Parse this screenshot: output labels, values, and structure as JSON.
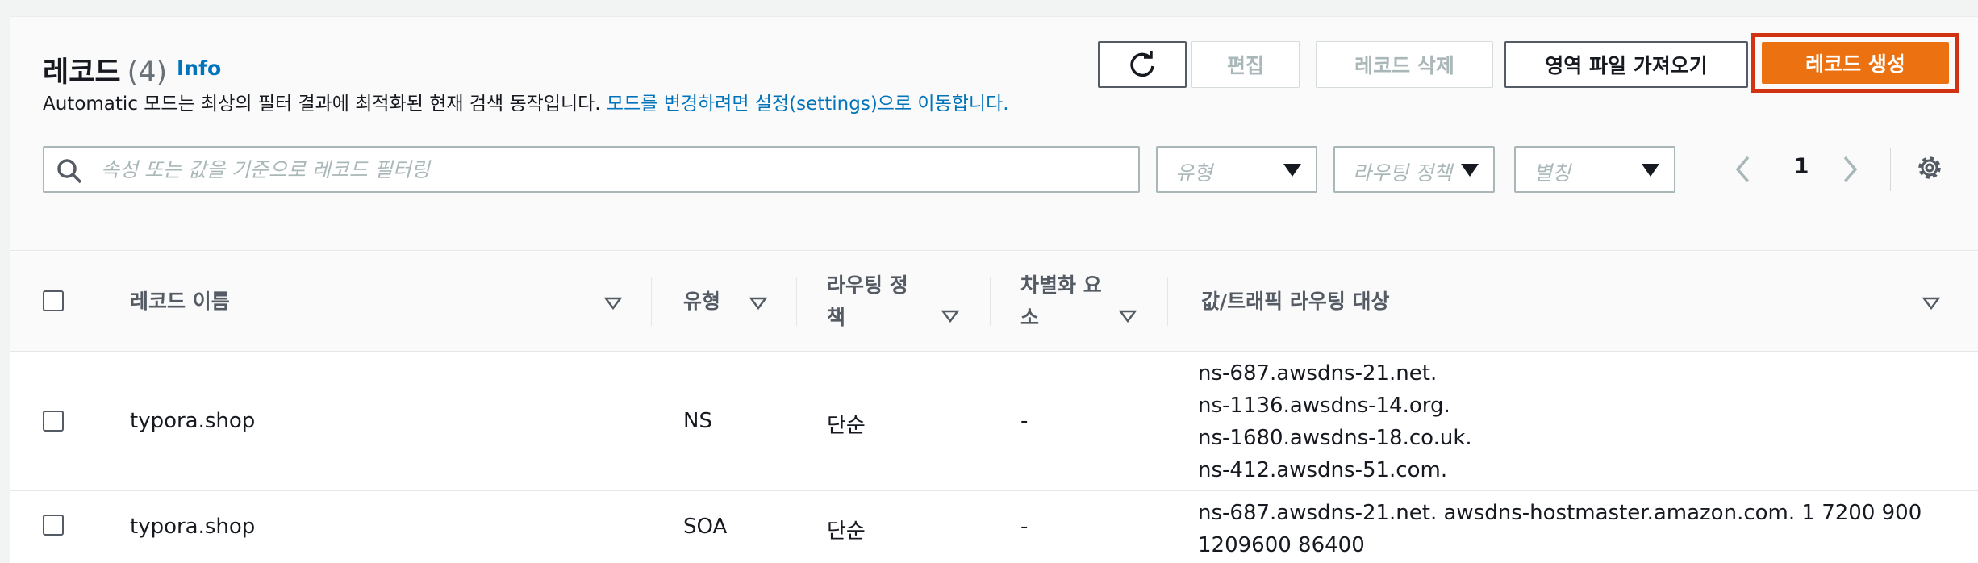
{
  "header": {
    "title": "레코드",
    "count": "(4)",
    "info": "Info",
    "description": "Automatic 모드는 최상의 필터 결과에 최적화된 현재 검색 동작입니다.",
    "description_link": "모드를 변경하려면 설정(settings)으로 이동합니다."
  },
  "toolbar": {
    "refresh_icon": "refresh-icon",
    "edit_label": "편집",
    "delete_label": "레코드 삭제",
    "import_label": "영역 파일 가져오기",
    "create_label": "레코드 생성",
    "highlight_color": "#d13212",
    "primary_color": "#ec7211"
  },
  "filters": {
    "search_placeholder": "속성 또는 값을 기준으로 레코드 필터링",
    "type_placeholder": "유형",
    "policy_placeholder": "라우팅 정책",
    "alias_placeholder": "별칭"
  },
  "pagination": {
    "current_page": "1"
  },
  "table": {
    "columns": [
      {
        "line1": "레코드 이름",
        "line2": ""
      },
      {
        "line1": "유형",
        "line2": ""
      },
      {
        "line1": "라우팅 정",
        "line2": "책"
      },
      {
        "line1": "차별화 요",
        "line2": "소"
      },
      {
        "line1": "값/트래픽 라우팅 대상",
        "line2": ""
      }
    ],
    "rows": [
      {
        "name": "typora.shop",
        "type": "NS",
        "policy": "단순",
        "differentiator": "-",
        "values": [
          "ns-687.awsdns-21.net.",
          "ns-1136.awsdns-14.org.",
          "ns-1680.awsdns-18.co.uk.",
          "ns-412.awsdns-51.com."
        ]
      },
      {
        "name": "typora.shop",
        "type": "SOA",
        "policy": "단순",
        "differentiator": "-",
        "values": [
          "ns-687.awsdns-21.net. awsdns-hostmaster.amazon.com. 1 7200 900",
          "1209600 86400"
        ]
      }
    ]
  }
}
